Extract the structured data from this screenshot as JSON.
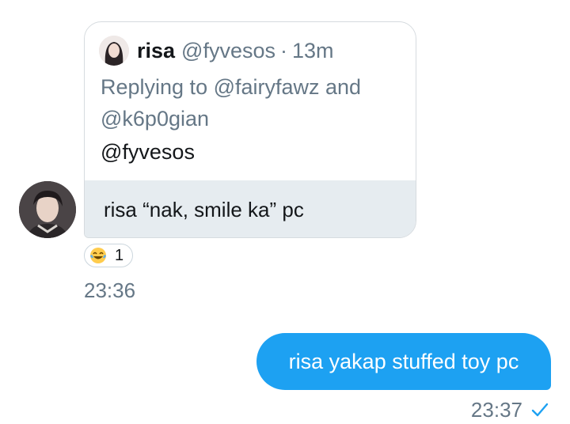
{
  "quote": {
    "name": "risa",
    "handle": "@fyvesos",
    "separator": "·",
    "time": "13m",
    "replying_to": "Replying to @fairyfawz and @k6p0gian",
    "body": "@fyvesos"
  },
  "received": {
    "text": "risa “nak, smile ka” pc",
    "reaction_emoji": "face-with-tears-of-joy-icon",
    "reaction_count": "1",
    "time": "23:36"
  },
  "sent": {
    "text": "risa yakap stuffed toy pc",
    "time": "23:37",
    "status_icon": "check-icon"
  },
  "colors": {
    "accent": "#1da1f2",
    "received_bg": "#e6ecf0",
    "secondary_text": "#657786"
  }
}
